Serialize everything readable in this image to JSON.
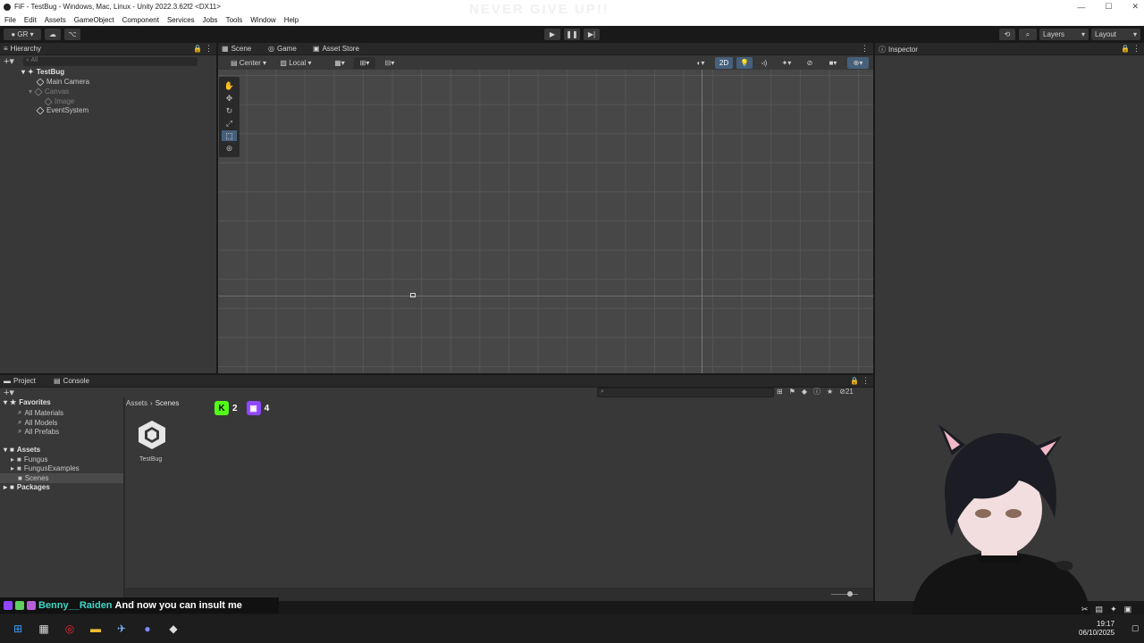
{
  "window": {
    "title": "FiF - TestBug - Windows, Mac, Linux - Unity 2022.3.62f2 <DX11>",
    "watermark": "NEVER GIVE UP!!",
    "btn_min": "—",
    "btn_max": "☐",
    "btn_close": "✕"
  },
  "menu": [
    "File",
    "Edit",
    "Assets",
    "GameObject",
    "Component",
    "Services",
    "Jobs",
    "Tools",
    "Window",
    "Help"
  ],
  "toolbar": {
    "account": "GR",
    "layers": "Layers",
    "layout": "Layout"
  },
  "hierarchy": {
    "tab": "Hierarchy",
    "search_placeholder": "All",
    "items": [
      {
        "label": "TestBug"
      },
      {
        "label": "Main Camera"
      },
      {
        "label": "Canvas"
      },
      {
        "label": "Image"
      },
      {
        "label": "EventSystem"
      }
    ]
  },
  "scene": {
    "tabs": [
      "Scene",
      "Game",
      "Asset Store"
    ],
    "pivot": "Center",
    "space": "Local",
    "mode_2d": "2D"
  },
  "inspector": {
    "tab": "Inspector"
  },
  "project": {
    "tabs": [
      "Project",
      "Console"
    ],
    "favorites": {
      "label": "Favorites",
      "items": [
        "All Materials",
        "All Models",
        "All Prefabs"
      ]
    },
    "assets": {
      "label": "Assets",
      "items": [
        "Fungus",
        "FungusExamples",
        "Scenes"
      ]
    },
    "packages": "Packages",
    "breadcrumb": [
      "Assets",
      "Scenes"
    ],
    "file": "TestBug",
    "count": "21"
  },
  "overlay": {
    "kick_count": "2",
    "twitch_count": "4"
  },
  "chat": {
    "user": "Benny__Raiden",
    "message": "And now you can insult me"
  },
  "taskbar": {
    "time": "19:17",
    "date": "06/10/2025"
  }
}
